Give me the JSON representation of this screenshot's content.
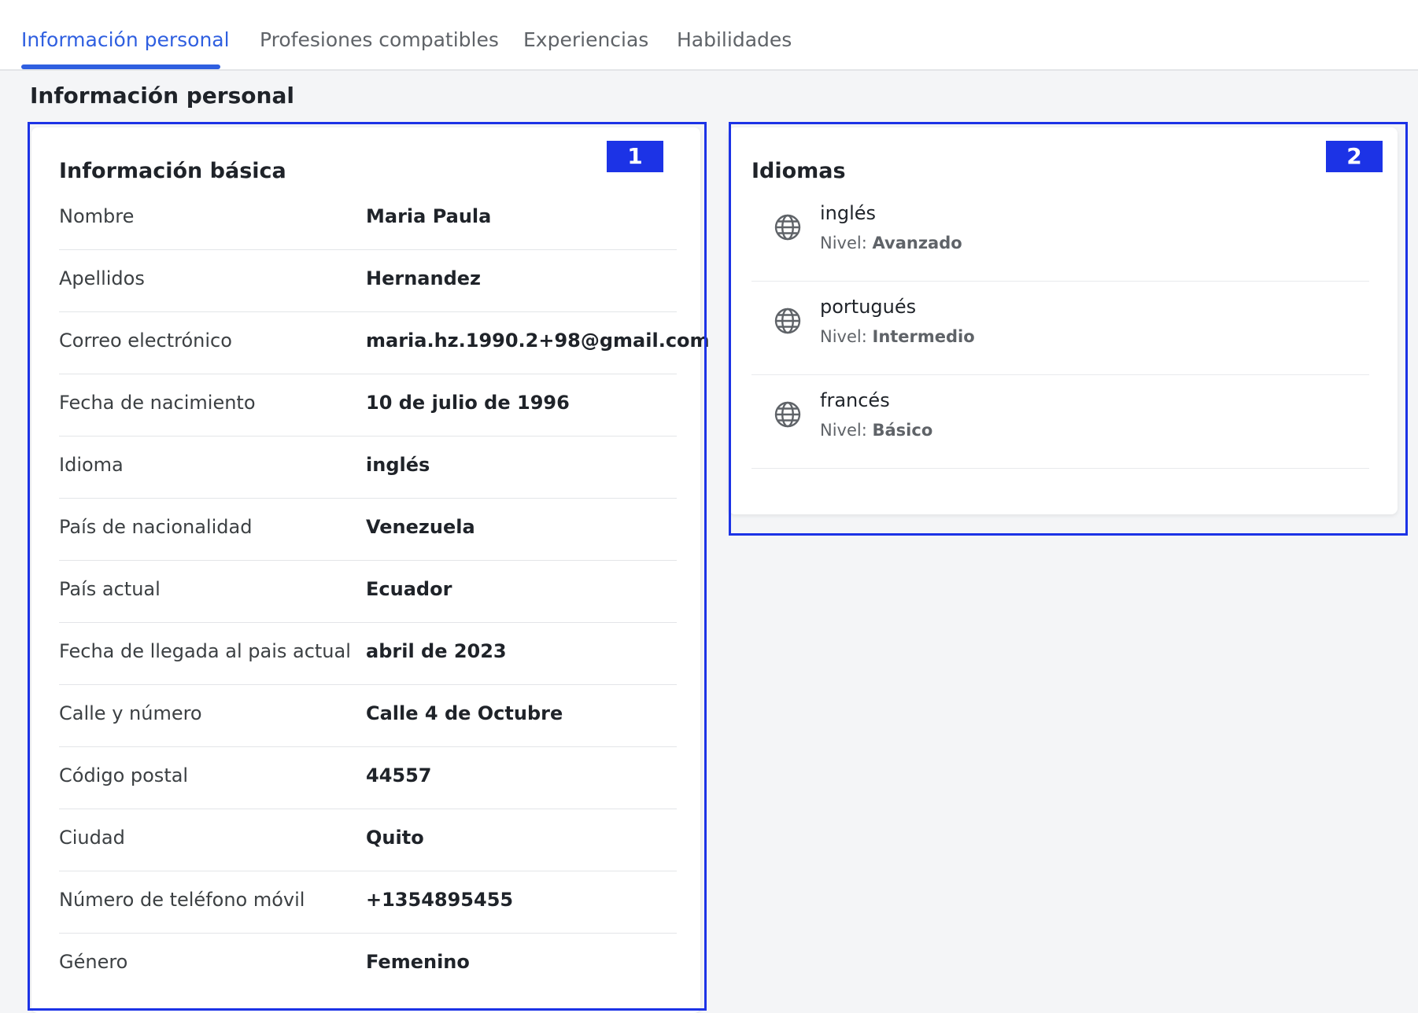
{
  "tabs": [
    {
      "label": "Información personal",
      "active": true
    },
    {
      "label": "Profesiones compatibles",
      "active": false
    },
    {
      "label": "Experiencias",
      "active": false
    },
    {
      "label": "Habilidades",
      "active": false
    }
  ],
  "section_title": "Información personal",
  "basic_info": {
    "title": "Información básica",
    "badge": "1",
    "rows": [
      {
        "label": "Nombre",
        "value": "Maria Paula"
      },
      {
        "label": "Apellidos",
        "value": "Hernandez"
      },
      {
        "label": "Correo electrónico",
        "value": "maria.hz.1990.2+98@gmail.com"
      },
      {
        "label": "Fecha de nacimiento",
        "value": "10 de julio de 1996"
      },
      {
        "label": "Idioma",
        "value": "inglés"
      },
      {
        "label": "País de nacionalidad",
        "value": "Venezuela"
      },
      {
        "label": "País actual",
        "value": "Ecuador"
      },
      {
        "label": "Fecha de llegada al pais actual",
        "value": "abril de 2023"
      },
      {
        "label": "Calle y número",
        "value": "Calle 4 de Octubre"
      },
      {
        "label": "Código postal",
        "value": "44557"
      },
      {
        "label": "Ciudad",
        "value": "Quito"
      },
      {
        "label": "Número de teléfono móvil",
        "value": "+1354895455"
      },
      {
        "label": "Género",
        "value": "Femenino"
      }
    ]
  },
  "languages": {
    "title": "Idiomas",
    "badge": "2",
    "level_prefix": "Nivel:",
    "items": [
      {
        "name": "inglés",
        "level": "Avanzado",
        "icon": "globe-icon"
      },
      {
        "name": "portugués",
        "level": "Intermedio",
        "icon": "globe-icon"
      },
      {
        "name": "francés",
        "level": "Básico",
        "icon": "globe-icon"
      }
    ]
  },
  "colors": {
    "accent": "#2f5fe0",
    "highlight": "#1c33e6",
    "background": "#f4f5f7"
  }
}
